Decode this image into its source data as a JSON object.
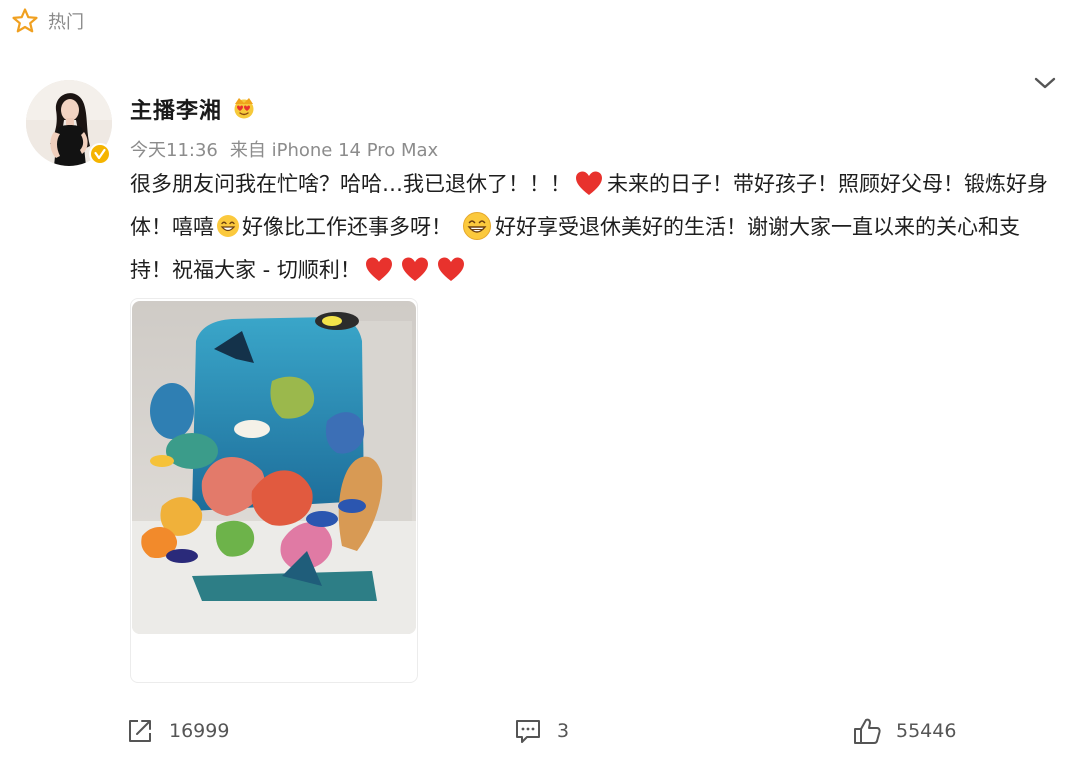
{
  "header": {
    "hot_label": "热门",
    "hot_icon": "star-outline-icon"
  },
  "post": {
    "author": {
      "name": "主播李湘",
      "badge_icon": "crown-emoji-icon",
      "verified_icon": "verified-v-icon",
      "verified_color": "#f5b400"
    },
    "time": "今天11:36",
    "source": "来自 iPhone 14 Pro Max",
    "text": {
      "part1": "很多朋友问我在忙啥？哈哈…我已退休了！！！",
      "part2": "未来的日子！带好孩子！照顾好父母！锻炼好身体！嘻嘻",
      "part3": "好像比工作还事多呀！",
      "part4": "好好享受退休美好的生活！谢谢大家一直以来的关心和支持！祝福大家 - 切顺利！"
    },
    "emoji": {
      "heart": "heart-emoji",
      "heart_color": "#e8322d",
      "grin": "grinning-emoji"
    },
    "image": "pop-up paper ocean reef artwork photo"
  },
  "actions": {
    "share_count": "16999",
    "comment_count": "3",
    "like_count": "55446",
    "share_icon": "share-icon",
    "comment_icon": "comment-icon",
    "like_icon": "thumbs-up-icon"
  }
}
